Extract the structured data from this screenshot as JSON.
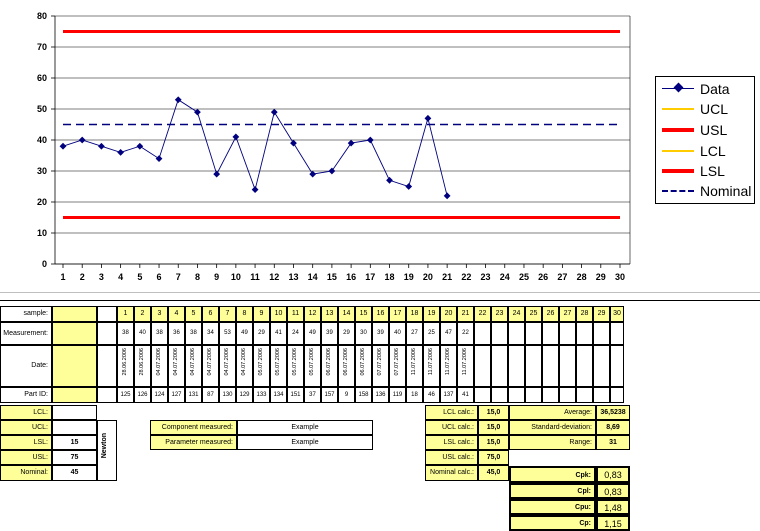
{
  "chart_data": {
    "type": "line",
    "x": [
      1,
      2,
      3,
      4,
      5,
      6,
      7,
      8,
      9,
      10,
      11,
      12,
      13,
      14,
      15,
      16,
      17,
      18,
      19,
      20,
      21,
      22,
      23,
      24,
      25,
      26,
      27,
      28,
      29,
      30
    ],
    "xlim": [
      1,
      30
    ],
    "ylim": [
      0,
      80
    ],
    "y_ticks": [
      "0",
      "10",
      "20",
      "30",
      "40",
      "50",
      "60",
      "70",
      "80"
    ],
    "x_ticks": [
      "1",
      "2",
      "3",
      "4",
      "5",
      "6",
      "7",
      "8",
      "9",
      "10",
      "11",
      "12",
      "13",
      "14",
      "15",
      "16",
      "17",
      "18",
      "19",
      "20",
      "21",
      "22",
      "23",
      "24",
      "25",
      "26",
      "27",
      "28",
      "29",
      "30"
    ],
    "grid": "horizontal",
    "legend_position": "right",
    "series": [
      {
        "name": "Data",
        "color": "#00007f",
        "style": "solid-marker",
        "x": [
          1,
          2,
          3,
          4,
          5,
          6,
          7,
          8,
          9,
          10,
          11,
          12,
          13,
          14,
          15,
          16,
          17,
          18,
          19,
          20,
          21
        ],
        "values": [
          38,
          40,
          38,
          36,
          38,
          34,
          53,
          49,
          29,
          41,
          24,
          49,
          39,
          29,
          30,
          39,
          40,
          27,
          25,
          47,
          22
        ]
      },
      {
        "name": "UCL",
        "color": "#ffcc00",
        "style": "solid",
        "values": []
      },
      {
        "name": "USL",
        "color": "#ff0000",
        "style": "thick",
        "x": [
          1,
          30
        ],
        "values": [
          75,
          75
        ]
      },
      {
        "name": "LCL",
        "color": "#ffcc00",
        "style": "solid",
        "values": []
      },
      {
        "name": "LSL",
        "color": "#ff0000",
        "style": "thick",
        "x": [
          1,
          30
        ],
        "values": [
          15,
          15
        ]
      },
      {
        "name": "Nominal",
        "color": "#00007f",
        "style": "dashed",
        "x": [
          1,
          30
        ],
        "values": [
          45,
          45
        ]
      }
    ]
  },
  "sheet": {
    "labels": {
      "sample": "sample:",
      "measurement": "Measurement:",
      "date": "Date:",
      "part_id": "Part ID:",
      "lcl": "LCL:",
      "ucl": "UCL:",
      "lsl": "LSL:",
      "usl": "USL:",
      "nominal": "Nominal:",
      "newton": "Newton",
      "component": "Component measured:",
      "parameter": "Parameter measured:",
      "lcl_calc": "LCL calc.:",
      "ucl_calc": "UCL calc.:",
      "lsl_calc": "LSL calc.:",
      "usl_calc": "USL calc.:",
      "nominal_calc": "Nominal calc.:",
      "average": "Average:",
      "std_dev": "Standard-deviation:",
      "range": "Range:",
      "cpk": "Cpk:",
      "cpl": "Cpl:",
      "cpu": "Cpu:",
      "cp": "Cp:"
    },
    "values": {
      "lsl": "15",
      "usl": "75",
      "nominal": "45",
      "component": "Example",
      "parameter": "Example",
      "lsl_calc": "15,0",
      "ucl_calc": "15,0",
      "lcl_calc": "15,0",
      "usl_calc": "75,0",
      "nominal_calc": "45,0",
      "average": "36,5238",
      "std_dev": "8,69",
      "range": "31",
      "cpk": "0,83",
      "cpl": "0,83",
      "cpu": "1,48",
      "cp": "1,15"
    },
    "samples": [
      "1",
      "2",
      "3",
      "4",
      "5",
      "6",
      "7",
      "8",
      "9",
      "10",
      "11",
      "12",
      "13",
      "14",
      "15",
      "16",
      "17",
      "18",
      "19",
      "20",
      "21",
      "22",
      "23",
      "24",
      "25",
      "26",
      "27",
      "28",
      "29",
      "30"
    ],
    "measurements": [
      "38",
      "40",
      "38",
      "36",
      "38",
      "34",
      "53",
      "49",
      "29",
      "41",
      "24",
      "49",
      "39",
      "29",
      "30",
      "39",
      "40",
      "27",
      "25",
      "47",
      "22"
    ],
    "dates": [
      "28.06.2006",
      "28.06.2006",
      "04.07.2006",
      "04.07.2006",
      "04.07.2006",
      "04.07.2006",
      "04.07.2006",
      "04.07.2006",
      "05.07.2006",
      "05.07.2006",
      "05.07.2006",
      "05.07.2006",
      "06.07.2006",
      "06.07.2006",
      "06.07.2006",
      "07.07.2006",
      "07.07.2006",
      "11.07.2006",
      "11.07.2006",
      "11.07.2006",
      "11.07.2006"
    ],
    "part_ids": [
      "125",
      "126",
      "124",
      "127",
      "131",
      "87",
      "130",
      "129",
      "133",
      "134",
      "151",
      "37",
      "157",
      "9",
      "158",
      "136",
      "119",
      "18",
      "46",
      "137",
      "41"
    ]
  }
}
